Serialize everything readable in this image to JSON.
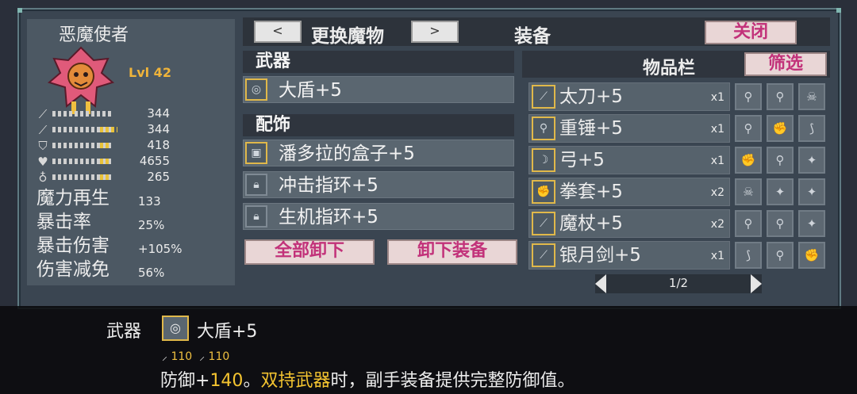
{
  "character": {
    "name": "恶魔使者",
    "level": "Lvl 42"
  },
  "stats": [
    {
      "icon": "sword-icon",
      "value": "344",
      "bar_color": "#d6d6d6"
    },
    {
      "icon": "wand-icon",
      "value": "344",
      "bar_color": "#e9c23a"
    },
    {
      "icon": "shield-icon",
      "value": "418",
      "bar_color": "#e9c23a"
    },
    {
      "icon": "heart-icon",
      "value": "4655",
      "bar_color": "#e9c23a"
    },
    {
      "icon": "potion-icon",
      "value": "265",
      "bar_color": "#e9c23a"
    }
  ],
  "big_stats": [
    {
      "label": "魔力再生",
      "value": "133"
    },
    {
      "label": "暴击率",
      "value": "25%"
    },
    {
      "label": "暴击伤害",
      "value": "+105%"
    },
    {
      "label": "伤害减免",
      "value": "56%"
    }
  ],
  "header": {
    "prev": "<",
    "next": ">",
    "swap_label": "更换魔物",
    "equip_label": "装备",
    "close": "关闭"
  },
  "weapon": {
    "section": "武器",
    "item": "大盾+5"
  },
  "accessory": {
    "section": "配饰",
    "items": [
      "潘多拉的盒子+5",
      "冲击指环+5",
      "生机指环+5"
    ]
  },
  "buttons": {
    "unequip_all": "全部卸下",
    "unequip": "卸下装备"
  },
  "inventory": {
    "title": "物品栏",
    "filter": "筛选",
    "items": [
      {
        "name": "太刀+5",
        "qty": "x1"
      },
      {
        "name": "重锤+5",
        "qty": "x1"
      },
      {
        "name": "弓+5",
        "qty": "x1"
      },
      {
        "name": "拳套+5",
        "qty": "x2"
      },
      {
        "name": "魔杖+5",
        "qty": "x2"
      },
      {
        "name": "银月剑+5",
        "qty": "x1"
      }
    ],
    "page": "1/2"
  },
  "detail": {
    "category": "武器",
    "item": "大盾+5",
    "atk": "110",
    "matk": "110",
    "desc_pre": "防御+",
    "desc_val": "140",
    "desc_mid": "。",
    "desc_hl": "双持武器",
    "desc_post": "时，副手装备提供完整防御值。"
  },
  "colors": {
    "accent": "#e0b84a",
    "button_text": "#c2327a",
    "highlight": "#f4c430"
  }
}
